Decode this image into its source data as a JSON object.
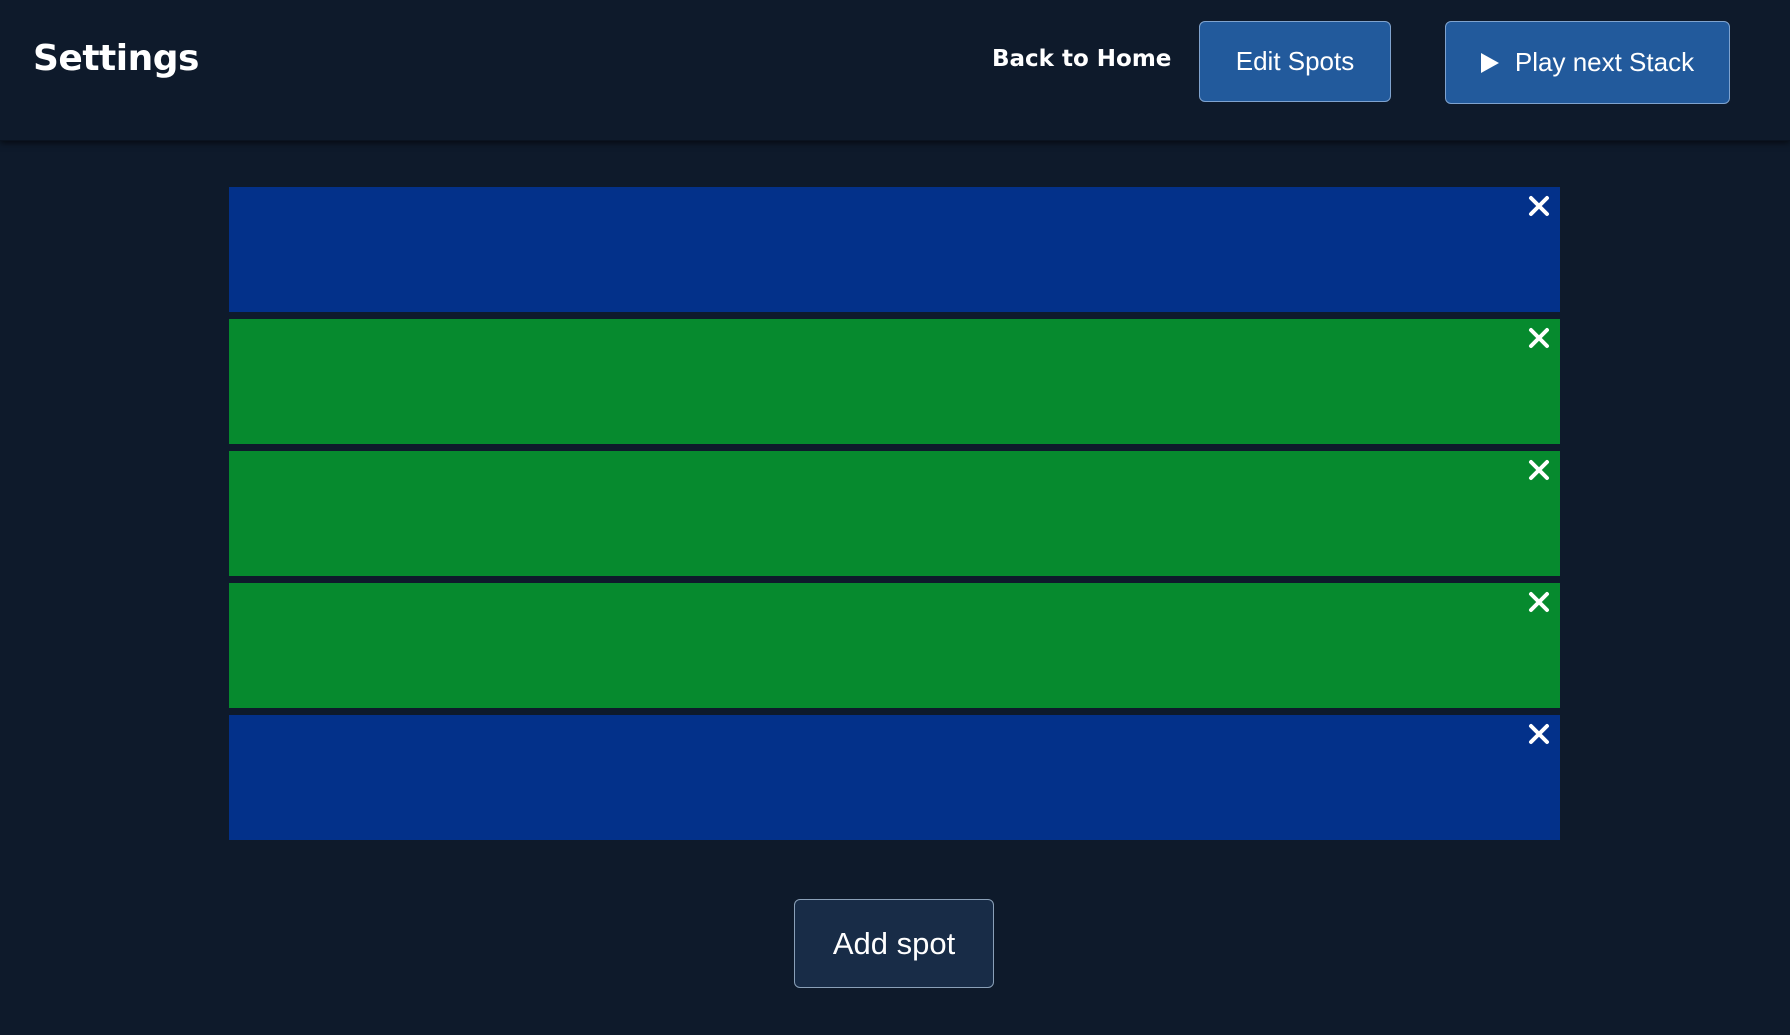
{
  "header": {
    "title": "Settings",
    "back_link": "Back to Home",
    "edit_button": "Edit Spots",
    "play_button": "Play next Stack",
    "play_icon": "play-icon"
  },
  "spots": [
    {
      "color": "#03318a",
      "close_icon": "close-icon"
    },
    {
      "color": "#068a2e",
      "close_icon": "close-icon"
    },
    {
      "color": "#068a2e",
      "close_icon": "close-icon"
    },
    {
      "color": "#068a2e",
      "close_icon": "close-icon"
    },
    {
      "color": "#03318a",
      "close_icon": "close-icon"
    }
  ],
  "footer": {
    "add_button": "Add spot"
  },
  "colors": {
    "background": "#0e1a2b",
    "button_blue": "#225a9c",
    "spot_blue": "#03318a",
    "spot_green": "#068a2e"
  }
}
